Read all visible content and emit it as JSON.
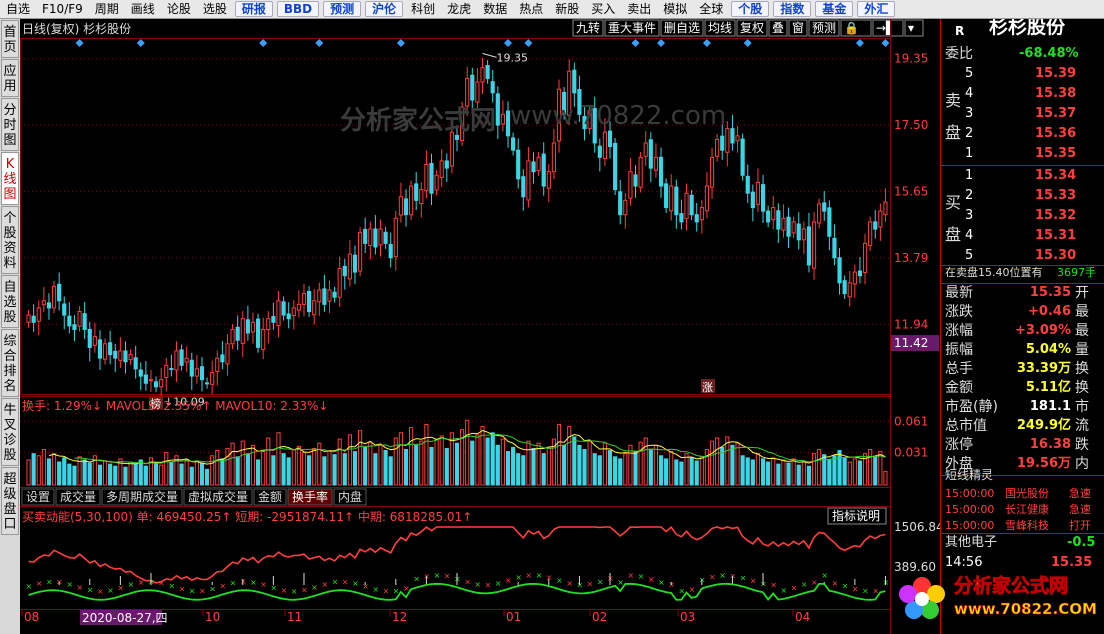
{
  "topbar": {
    "items": [
      {
        "label": "自选",
        "hl": false
      },
      {
        "label": "F10/F9",
        "hl": false
      },
      {
        "label": "周期",
        "hl": false
      },
      {
        "label": "画线",
        "hl": false
      },
      {
        "label": "论股",
        "hl": false
      },
      {
        "label": "选股",
        "hl": false
      },
      {
        "label": "研报",
        "hl": true
      },
      {
        "label": "BBD",
        "hl": true
      },
      {
        "label": "预测",
        "hl": true
      },
      {
        "label": "沪伦",
        "hl": true
      },
      {
        "label": "科创",
        "hl": false
      },
      {
        "label": "龙虎",
        "hl": false
      },
      {
        "label": "数据",
        "hl": false
      },
      {
        "label": "热点",
        "hl": false
      },
      {
        "label": "新股",
        "hl": false
      },
      {
        "label": "买入",
        "hl": false
      },
      {
        "label": "卖出",
        "hl": false
      },
      {
        "label": "模拟",
        "hl": false
      },
      {
        "label": "全球",
        "hl": false
      },
      {
        "label": "个股",
        "hl": true
      },
      {
        "label": "指数",
        "hl": true
      },
      {
        "label": "基金",
        "hl": true
      },
      {
        "label": "外汇",
        "hl": true
      }
    ]
  },
  "leftnav": [
    {
      "label": "首页",
      "active": false
    },
    {
      "label": "应用",
      "active": false
    },
    {
      "label": "分时图",
      "active": false
    },
    {
      "label": "K线图",
      "active": true
    },
    {
      "label": "个股资料",
      "active": false
    },
    {
      "label": "自选股",
      "active": false
    },
    {
      "label": "综合排名",
      "active": false
    },
    {
      "label": "牛叉诊股",
      "active": false
    },
    {
      "label": "超级盘口",
      "active": false
    }
  ],
  "chart_header": {
    "title": "日线(复权)  杉杉股份",
    "tools": [
      "九转",
      "重大事件",
      "删自选",
      "均线",
      "复权",
      "叠",
      "窗",
      "预测",
      "🔒",
      "→▌",
      "▾"
    ]
  },
  "chart_data": [
    {
      "type": "candlestick",
      "title": "日线(复权) 杉杉股份",
      "y_ticks": [
        "19.35",
        "17.50",
        "15.65",
        "13.79",
        "11.94",
        "11.42"
      ],
      "ylim": [
        10.0,
        19.9
      ],
      "current_price_tag": "11.42",
      "annotations": [
        {
          "text": "19.35",
          "type": "high"
        },
        {
          "text": "10.09",
          "type": "low"
        },
        {
          "text": "榜",
          "type": "marker"
        },
        {
          "text": "涨",
          "type": "marker"
        }
      ],
      "x_ticks": [
        "08",
        "10",
        "11",
        "12",
        "01",
        "02",
        "03",
        "04"
      ],
      "x_cursor_label": "2020-08-27,四",
      "closes": [
        12.2,
        12.0,
        12.4,
        12.6,
        12.4,
        13.0,
        12.6,
        12.2,
        11.9,
        11.8,
        12.3,
        11.8,
        11.3,
        11.6,
        11.0,
        11.4,
        11.1,
        11.0,
        11.2,
        10.9,
        11.1,
        10.7,
        10.5,
        10.3,
        10.4,
        10.2,
        10.4,
        10.8,
        10.7,
        11.2,
        10.8,
        11.0,
        10.5,
        10.7,
        10.4,
        10.3,
        10.6,
        11.0,
        10.9,
        11.4,
        11.8,
        11.5,
        12.1,
        11.7,
        12.0,
        11.3,
        11.8,
        12.1,
        12.0,
        12.6,
        12.2,
        12.1,
        12.4,
        12.5,
        12.8,
        12.3,
        12.6,
        12.9,
        12.5,
        12.9,
        12.7,
        13.5,
        13.3,
        13.9,
        13.4,
        14.5,
        14.2,
        14.6,
        14.1,
        14.6,
        14.2,
        13.8,
        14.9,
        15.5,
        15.0,
        15.8,
        15.4,
        15.7,
        16.4,
        15.6,
        16.1,
        16.5,
        16.3,
        17.3,
        17.1,
        18.0,
        18.8,
        18.2,
        18.7,
        19.1,
        18.8,
        18.4,
        17.5,
        17.8,
        17.2,
        16.8,
        16.0,
        15.5,
        16.5,
        16.2,
        16.6,
        15.8,
        16.2,
        17.0,
        18.5,
        17.8,
        19.0,
        18.4,
        17.8,
        17.4,
        17.9,
        17.0,
        16.6,
        17.3,
        16.9,
        15.7,
        15.0,
        15.4,
        16.2,
        15.8,
        16.6,
        17.0,
        16.3,
        16.6,
        15.8,
        15.2,
        15.8,
        15.0,
        14.8,
        15.6,
        15.0,
        14.8,
        15.2,
        15.8,
        16.6,
        17.1,
        16.8,
        17.4,
        17.0,
        17.2,
        16.1,
        15.6,
        15.2,
        15.9,
        15.1,
        14.8,
        15.2,
        14.6,
        14.9,
        14.4,
        14.8,
        14.3,
        14.6,
        13.6,
        14.8,
        15.3,
        15.1,
        14.4,
        13.8,
        13.1,
        12.8,
        13.1,
        13.4,
        13.3,
        14.2,
        14.8,
        14.6,
        15.1,
        15.35
      ],
      "volume_title": "换手: 1.29%↓  MAVOL5: 2.35%↑  MAVOL10: 2.33%↓",
      "volume_y_ticks": [
        "0.061",
        "0.031"
      ],
      "volume": [
        0.024,
        0.03,
        0.028,
        0.034,
        0.025,
        0.03,
        0.022,
        0.026,
        0.02,
        0.018,
        0.027,
        0.024,
        0.021,
        0.028,
        0.019,
        0.023,
        0.02,
        0.018,
        0.025,
        0.017,
        0.022,
        0.02,
        0.024,
        0.018,
        0.026,
        0.021,
        0.019,
        0.031,
        0.022,
        0.028,
        0.02,
        0.024,
        0.017,
        0.023,
        0.021,
        0.015,
        0.028,
        0.033,
        0.025,
        0.035,
        0.04,
        0.027,
        0.042,
        0.03,
        0.038,
        0.024,
        0.032,
        0.045,
        0.028,
        0.05,
        0.03,
        0.026,
        0.034,
        0.037,
        0.031,
        0.028,
        0.035,
        0.04,
        0.027,
        0.033,
        0.029,
        0.044,
        0.03,
        0.048,
        0.032,
        0.052,
        0.036,
        0.041,
        0.03,
        0.038,
        0.033,
        0.027,
        0.045,
        0.05,
        0.034,
        0.055,
        0.038,
        0.042,
        0.058,
        0.036,
        0.044,
        0.047,
        0.035,
        0.05,
        0.04,
        0.053,
        0.062,
        0.042,
        0.048,
        0.056,
        0.045,
        0.05,
        0.038,
        0.044,
        0.032,
        0.036,
        0.03,
        0.028,
        0.042,
        0.035,
        0.04,
        0.03,
        0.035,
        0.044,
        0.058,
        0.038,
        0.056,
        0.046,
        0.038,
        0.034,
        0.042,
        0.03,
        0.028,
        0.04,
        0.033,
        0.027,
        0.025,
        0.03,
        0.038,
        0.032,
        0.041,
        0.045,
        0.034,
        0.038,
        0.028,
        0.025,
        0.032,
        0.024,
        0.022,
        0.03,
        0.026,
        0.023,
        0.027,
        0.034,
        0.042,
        0.045,
        0.036,
        0.046,
        0.038,
        0.04,
        0.028,
        0.026,
        0.024,
        0.03,
        0.025,
        0.022,
        0.026,
        0.02,
        0.024,
        0.021,
        0.025,
        0.019,
        0.022,
        0.018,
        0.03,
        0.034,
        0.029,
        0.024,
        0.028,
        0.033,
        0.026,
        0.022,
        0.025,
        0.023,
        0.03,
        0.034,
        0.027,
        0.032,
        0.013
      ],
      "volume_tabs": [
        "设置",
        "成交量",
        "多周期成交量",
        "虚拟成交量",
        "金额",
        "换手率",
        "内盘"
      ],
      "volume_active_tab": "换手率",
      "indicator_title": "买卖动能(5,30,100) 单: 469450.25↑ 短期: -2951874.11↑ 中期: 6818285.01↑",
      "indicator_button": "指标说明",
      "indicator_y_ticks": [
        "1506.84",
        "389.60"
      ]
    }
  ],
  "right_panel": {
    "stock_code_mark": "R",
    "stock_name": "杉杉股份",
    "weibi": {
      "label": "委比",
      "value": "-68.48%"
    },
    "sell_label": [
      "卖",
      "盘"
    ],
    "buy_label": [
      "买",
      "盘"
    ],
    "asks": [
      {
        "level": "5",
        "price": "15.39"
      },
      {
        "level": "4",
        "price": "15.38"
      },
      {
        "level": "3",
        "price": "15.37"
      },
      {
        "level": "2",
        "price": "15.36"
      },
      {
        "level": "1",
        "price": "15.35"
      }
    ],
    "bids": [
      {
        "level": "1",
        "price": "15.34"
      },
      {
        "level": "2",
        "price": "15.33"
      },
      {
        "level": "3",
        "price": "15.32"
      },
      {
        "level": "4",
        "price": "15.31"
      },
      {
        "level": "5",
        "price": "15.30"
      }
    ],
    "position_note": "在卖盘15.40位置有",
    "position_qty": "3697手",
    "quotes": [
      {
        "label": "最新",
        "value": "15.35",
        "color": "red",
        "suffix": "开"
      },
      {
        "label": "涨跌",
        "value": "+0.46",
        "color": "red",
        "suffix": "最"
      },
      {
        "label": "涨幅",
        "value": "+3.09%",
        "color": "red",
        "suffix": "最"
      },
      {
        "label": "振幅",
        "value": "5.04%",
        "color": "yellow",
        "suffix": "量"
      },
      {
        "label": "总手",
        "value": "33.39万",
        "color": "yellow",
        "suffix": "换"
      },
      {
        "label": "金额",
        "value": "5.11亿",
        "color": "yellow",
        "suffix": "换"
      },
      {
        "label": "市盈(静)",
        "value": "181.1",
        "color": "white",
        "suffix": "市"
      },
      {
        "label": "总市值",
        "value": "249.9亿",
        "color": "yellow",
        "suffix": "流"
      },
      {
        "label": "涨停",
        "value": "16.38",
        "color": "red",
        "suffix": "跌"
      },
      {
        "label": "外盘",
        "value": "19.56万",
        "color": "red",
        "suffix": "内"
      }
    ],
    "sprite_title": "短线精灵",
    "sprite_rows": [
      {
        "time": "15:00:00",
        "name": "国光股份",
        "event": "急速"
      },
      {
        "time": "15:00:00",
        "name": "长江健康",
        "event": "急速"
      },
      {
        "time": "15:00:00",
        "name": "雪峰科技",
        "event": "打开"
      }
    ],
    "other": {
      "label": "其他电子",
      "value": "-0.5"
    },
    "tick": {
      "time": "14:56",
      "price": "15.35"
    }
  },
  "watermark": {
    "text": "分析家公式网",
    "url": "www.70822.com"
  },
  "logo": {
    "title": "分析家公式网",
    "url": "www.70822.COM"
  },
  "colors": {
    "up": "#ff3c3c",
    "down": "#3ad6e6",
    "grid": "#8b0000",
    "line_red": "#ff4040",
    "line_green": "#20e020",
    "bg": "#000000"
  }
}
